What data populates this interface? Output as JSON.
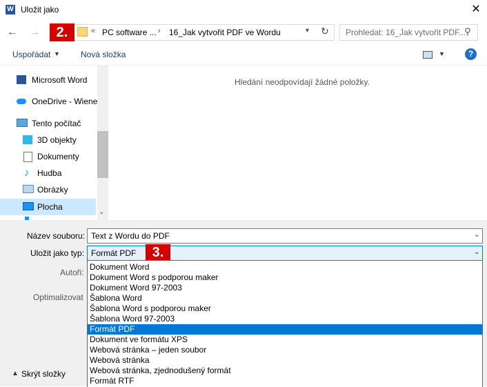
{
  "window": {
    "title": "Uložit jako",
    "app_icon": "W"
  },
  "address": {
    "chevron": "«",
    "crumbs": [
      "PC software ...",
      "16_Jak vytvořit PDF ve Wordu"
    ],
    "separator": "›"
  },
  "search": {
    "placeholder": "Prohledat: 16_Jak vytvořit PDF..."
  },
  "markers": {
    "two": "2.",
    "three": "3."
  },
  "toolbar": {
    "organize": "Uspořádat",
    "new_folder": "Nová složka",
    "help": "?"
  },
  "nav": {
    "items": [
      {
        "label": "Microsoft Word",
        "icon": "word-icon"
      },
      {
        "label": "OneDrive - Wiene",
        "icon": "cloud-icon"
      },
      {
        "label": "Tento počítač",
        "icon": "computer-icon"
      },
      {
        "label": "3D objekty",
        "icon": "cube-icon"
      },
      {
        "label": "Dokumenty",
        "icon": "document-icon"
      },
      {
        "label": "Hudba",
        "icon": "music-icon"
      },
      {
        "label": "Obrázky",
        "icon": "picture-icon"
      },
      {
        "label": "Plocha",
        "icon": "desktop-icon"
      }
    ],
    "selected": "Plocha"
  },
  "content": {
    "empty_message": "Hledání neodpovídají žádné položky."
  },
  "form": {
    "filename_label": "Název souboru:",
    "filename_value": "Text z Wordu do PDF",
    "filetype_label": "Uložit jako typ:",
    "filetype_value": "Formát PDF",
    "authors_label": "Autoři:",
    "optimize_label": "Optimalizovat"
  },
  "dropdown_options": [
    "Dokument Word",
    "Dokument Word s podporou maker",
    "Dokument Word 97-2003",
    "Šablona Word",
    "Šablona Word s podporou maker",
    "Šablona Word 97-2003",
    "Formát PDF",
    "Dokument ve formátu XPS",
    "Webová stránka – jeden soubor",
    "Webová stránka",
    "Webová stránka, zjednodušený formát",
    "Formát RTF"
  ],
  "dropdown_selected_index": 6,
  "footer": {
    "hide_folders": "Skrýt složky"
  },
  "colors": {
    "selection": "#0078d7",
    "marker": "#d40000",
    "nav_selected": "#cce8ff",
    "panel": "#f0f0f0"
  }
}
